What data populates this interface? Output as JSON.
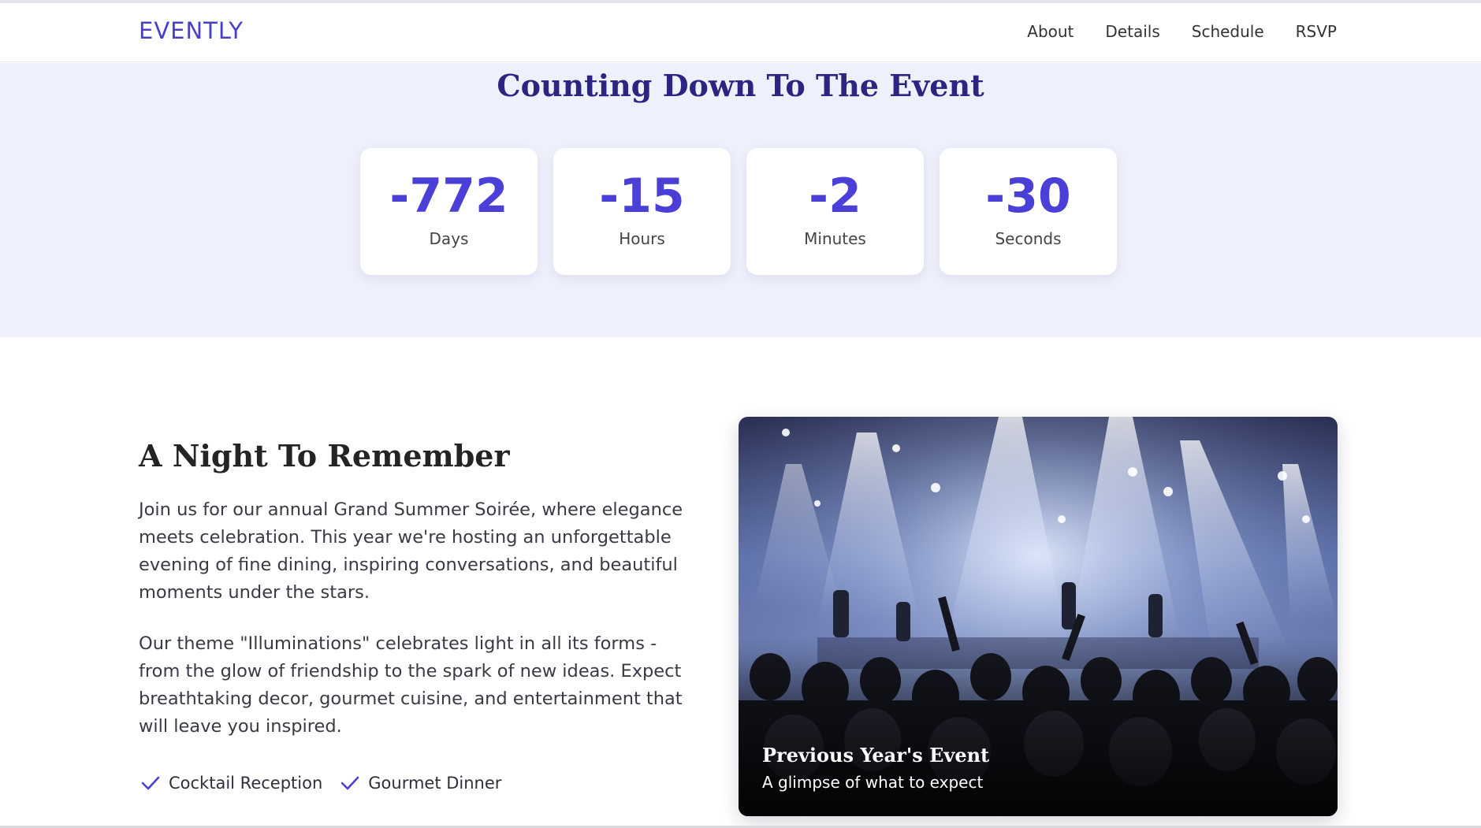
{
  "nav": {
    "brand": "EVENTLY",
    "links": [
      "About",
      "Details",
      "Schedule",
      "RSVP"
    ]
  },
  "countdown": {
    "title": "Counting Down To The Event",
    "units": [
      {
        "value": "-772",
        "label": "Days"
      },
      {
        "value": "-15",
        "label": "Hours"
      },
      {
        "value": "-2",
        "label": "Minutes"
      },
      {
        "value": "-30",
        "label": "Seconds"
      }
    ]
  },
  "about": {
    "heading": "A Night To Remember",
    "paragraph1": "Join us for our annual Grand Summer Soirée, where elegance meets celebration. This year we're hosting an unforgettable evening of fine dining, inspiring conversations, and beautiful moments under the stars.",
    "paragraph2": "Our theme \"Illuminations\" celebrates light in all its forms - from the glow of friendship to the spark of new ideas. Expect breathtaking decor, gourmet cuisine, and entertainment that will leave you inspired.",
    "features": [
      "Cocktail Reception",
      "Gourmet Dinner"
    ]
  },
  "image": {
    "caption_title": "Previous Year's Event",
    "caption_subtitle": "A glimpse of what to expect"
  },
  "colors": {
    "accent": "#4a3fd6",
    "brand": "#4a3fc9",
    "heading_dark": "#2b2480",
    "countdown_bg": "#eef0fc"
  },
  "icons": {
    "feature_check": "check-icon",
    "concert_photo": "concert-crowd-photo"
  }
}
